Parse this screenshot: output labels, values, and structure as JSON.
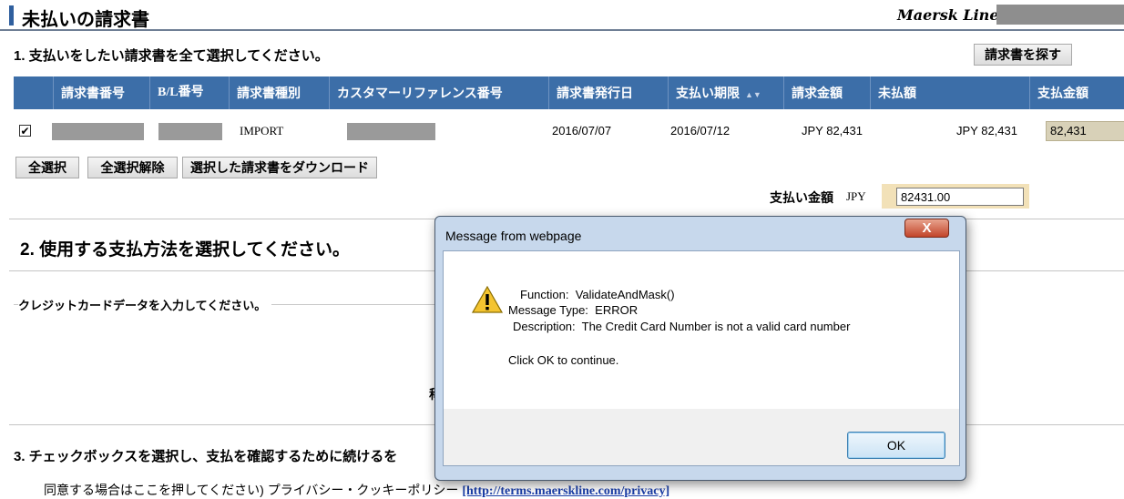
{
  "header": {
    "title": "未払いの請求書",
    "brand": "Maersk Line:"
  },
  "section1": {
    "label": "1. 支払いをしたい請求書を全て選択してください。",
    "find_button": "請求書を探す"
  },
  "table": {
    "columns": [
      "請求書番号",
      "B/L番号",
      "請求書種別",
      "カスタマーリファレンス番号",
      "請求書発行日",
      "支払い期限",
      "請求金額",
      "未払額",
      "支払金額"
    ],
    "rows": [
      {
        "checked": "✔",
        "invoice_type": "IMPORT",
        "issue_date": "2016/07/07",
        "due_date": "2016/07/12",
        "invoice_amount": "JPY 82,431",
        "outstanding": "JPY 82,431",
        "payment": "82,431"
      }
    ]
  },
  "actions": {
    "select_all": "全選択",
    "deselect_all": "全選択解除",
    "download": "選択した請求書をダウンロード"
  },
  "payment_amount": {
    "label": "支払い金額",
    "currency": "JPY",
    "value": "82431.00"
  },
  "section2": {
    "label": "2. 使用する支払方法を選択してください。",
    "cc_legend": "クレジットカードデータを入力してください。",
    "partial_char": "称"
  },
  "section3": {
    "label": "3. チェックボックスを選択し、支払を確認するために続けるを",
    "agree_text": "同意する場合はここを押してください) プライバシー・クッキーポリシー ",
    "agree_link": "[http://terms.maerskline.com/privacy]"
  },
  "dialog": {
    "title": "Message from webpage",
    "close": "X",
    "line1": "Function:  ValidateAndMask()",
    "line2": "Message Type:  ERROR",
    "line3": "Description:  The Credit Card Number is not a valid card number",
    "line4": "Click OK to continue.",
    "ok": "OK",
    "icon": "warning-icon"
  }
}
